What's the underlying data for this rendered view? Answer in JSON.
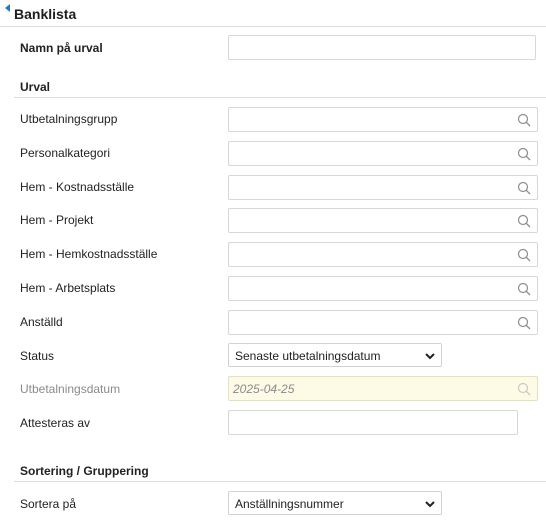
{
  "header": {
    "title": "Banklista"
  },
  "name_field": {
    "label": "Namn på urval",
    "value": ""
  },
  "urval": {
    "title": "Urval",
    "lookups": [
      {
        "label": "Utbetalningsgrupp",
        "value": ""
      },
      {
        "label": "Personalkategori",
        "value": ""
      },
      {
        "label": "Hem - Kostnadsställe",
        "value": ""
      },
      {
        "label": "Hem - Projekt",
        "value": ""
      },
      {
        "label": "Hem - Hemkostnadsställe",
        "value": ""
      },
      {
        "label": "Hem - Arbetsplats",
        "value": ""
      },
      {
        "label": "Anställd",
        "value": ""
      }
    ],
    "status": {
      "label": "Status",
      "value": "Senaste utbetalningsdatum"
    },
    "payment_date": {
      "label": "Utbetalningsdatum",
      "value": "2025-04-25"
    },
    "attest": {
      "label": "Attesteras av",
      "value": ""
    }
  },
  "sorting": {
    "title": "Sortering / Gruppering",
    "sort_on": {
      "label": "Sortera på",
      "value": "Anställningsnummer"
    }
  },
  "colors": {
    "accent": "#1f7ac9",
    "disabled_bg": "#fdfbe6"
  },
  "icons": {
    "lookup": "search-icon",
    "collapse": "collapse-arrow-icon",
    "dropdown": "chevron-down-icon"
  }
}
